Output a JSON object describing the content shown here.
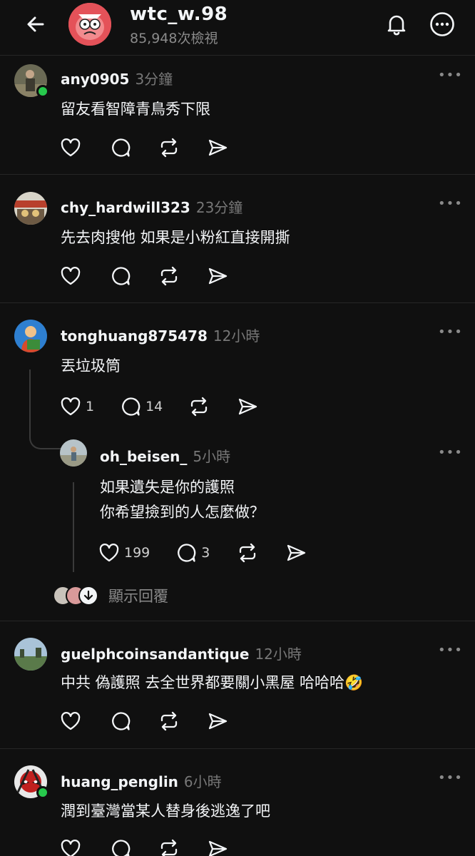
{
  "header": {
    "title": "wtc_w.98",
    "views": "85,948次檢視"
  },
  "comments": [
    {
      "username": "any0905",
      "time": "3分鐘",
      "text": "留友看智障青鳥秀下限",
      "more": "•••"
    },
    {
      "username": "chy_hardwill323",
      "time": "23分鐘",
      "text": "先去肉搜他 如果是小粉紅直接開撕",
      "more": "•••"
    },
    {
      "username": "tonghuang875478",
      "time": "12小時",
      "text": "丟垃圾筒",
      "likes": "1",
      "replies": "14",
      "more": "•••"
    },
    {
      "username": "oh_beisen_",
      "time": "5小時",
      "text_line1": "如果遺失是你的護照",
      "text_line2": "你希望撿到的人怎麼做？",
      "likes": "199",
      "replies": "3",
      "more": "•••"
    },
    {
      "username": "guelphcoinsandantique",
      "time": "12小時",
      "text": "中共 偽護照 去全世界都要關小黑屋 哈哈哈🤣",
      "more": "•••"
    },
    {
      "username": "huang_penglin",
      "time": "6小時",
      "text": "潤到臺灣當某人替身後逃逸了吧",
      "more": "•••"
    }
  ],
  "show_replies": "顯示回覆",
  "colors": {
    "background": "#101010",
    "text": "#f3f5f7",
    "muted": "#777777",
    "online": "#27c94c"
  }
}
